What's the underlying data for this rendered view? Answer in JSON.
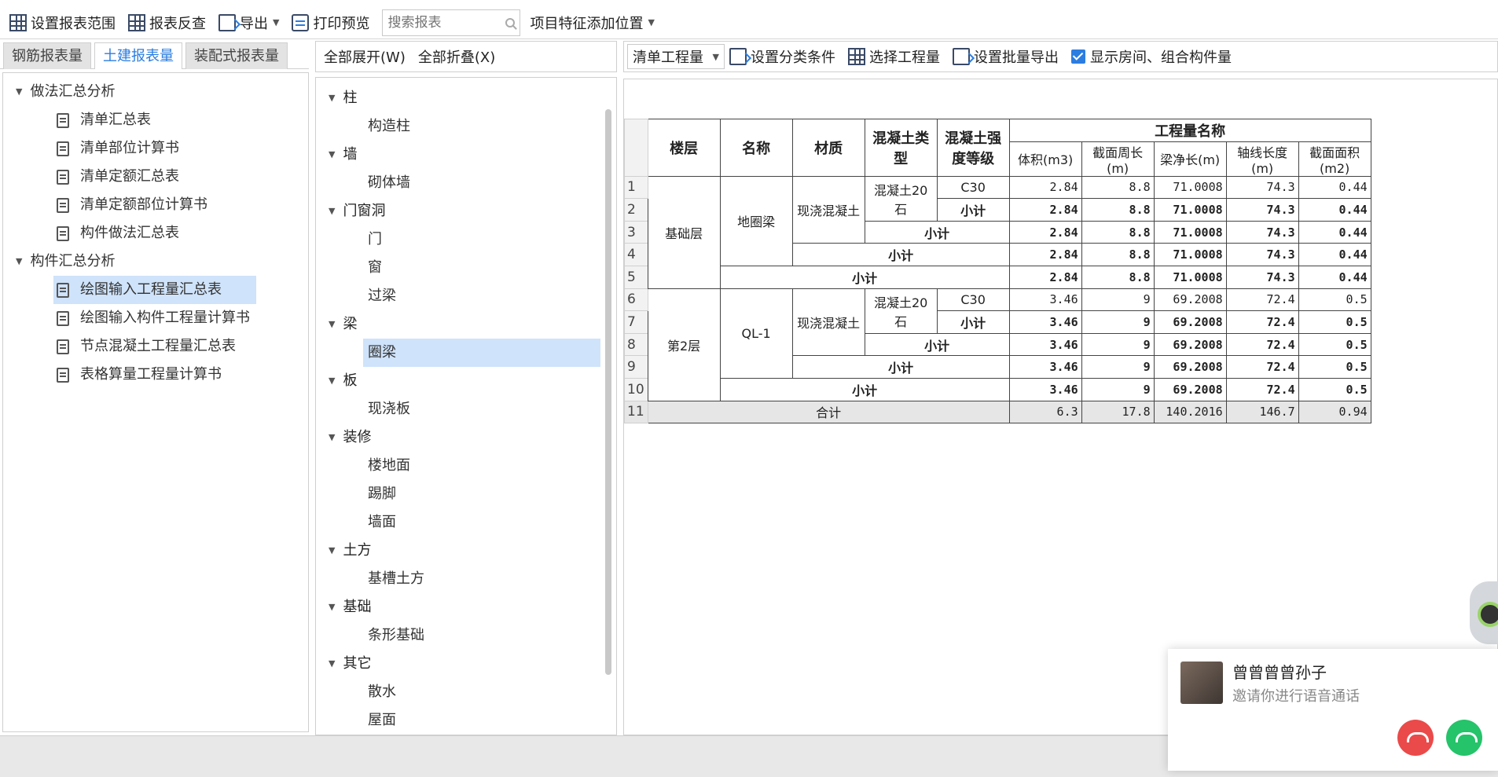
{
  "toolbar": {
    "items": [
      {
        "label": "设置报表范围",
        "icon": "grid-icon"
      },
      {
        "label": "报表反查",
        "icon": "report-search-icon"
      },
      {
        "label": "导出",
        "icon": "export-icon"
      },
      {
        "label": "打印预览",
        "icon": "print-icon"
      }
    ],
    "search_placeholder": "搜索报表",
    "feature_position_label": "项目特征添加位置"
  },
  "left_tabs": [
    "钢筋报表量",
    "土建报表量",
    "装配式报表量"
  ],
  "left_tree": {
    "groups": [
      {
        "label": "做法汇总分析",
        "items": [
          "清单汇总表",
          "清单部位计算书",
          "清单定额汇总表",
          "清单定额部位计算书",
          "构件做法汇总表"
        ]
      },
      {
        "label": "构件汇总分析",
        "items": [
          "绘图输入工程量汇总表",
          "绘图输入构件工程量计算书",
          "节点混凝土工程量汇总表",
          "表格算量工程量计算书"
        ]
      }
    ]
  },
  "mid_panel": {
    "expand_all": "全部展开(W)",
    "collapse_all": "全部折叠(X)",
    "categories": [
      {
        "label": "柱",
        "items": [
          "构造柱"
        ]
      },
      {
        "label": "墙",
        "items": [
          "砌体墙"
        ]
      },
      {
        "label": "门窗洞",
        "items": [
          "门",
          "窗",
          "过梁"
        ]
      },
      {
        "label": "梁",
        "items": [
          "圈梁"
        ]
      },
      {
        "label": "板",
        "items": [
          "现浇板"
        ]
      },
      {
        "label": "装修",
        "items": [
          "楼地面",
          "踢脚",
          "墙面"
        ]
      },
      {
        "label": "土方",
        "items": [
          "基槽土方"
        ]
      },
      {
        "label": "基础",
        "items": [
          "条形基础"
        ]
      },
      {
        "label": "其它",
        "items": [
          "散水",
          "屋面"
        ]
      }
    ]
  },
  "right_toolbar": {
    "qty_select": "清单工程量",
    "set_category": "设置分类条件",
    "select_qty": "选择工程量",
    "batch_export": "设置批量导出",
    "show_room": "显示房间、组合构件量"
  },
  "table": {
    "headers": {
      "floor": "楼层",
      "name": "名称",
      "material": "材质",
      "concrete_type": "混凝土类型",
      "strength": "混凝土强度等级",
      "qty_group": "工程量名称",
      "vol": "体积(m3)",
      "perimeter": "截面周长(m)",
      "net_len": "梁净长(m)",
      "axis_len": "轴线长度(m)",
      "area": "截面面积(m2)"
    },
    "subtotal": "小计",
    "total": "合计",
    "rows": {
      "r1": {
        "floor": "基础层",
        "name": "地圈梁",
        "material": "现浇混凝土",
        "ctype": "混凝土20石",
        "grade": "C30",
        "vol": "2.84",
        "per": "8.8",
        "net": "71.0008",
        "axis": "74.3",
        "area": "0.44"
      },
      "r2": {
        "vol": "2.84",
        "per": "8.8",
        "net": "71.0008",
        "axis": "74.3",
        "area": "0.44"
      },
      "r3": {
        "vol": "2.84",
        "per": "8.8",
        "net": "71.0008",
        "axis": "74.3",
        "area": "0.44"
      },
      "r4": {
        "vol": "2.84",
        "per": "8.8",
        "net": "71.0008",
        "axis": "74.3",
        "area": "0.44"
      },
      "r5": {
        "vol": "2.84",
        "per": "8.8",
        "net": "71.0008",
        "axis": "74.3",
        "area": "0.44"
      },
      "r6": {
        "floor": "第2层",
        "name": "QL-1",
        "material": "现浇混凝土",
        "ctype": "混凝土20石",
        "grade": "C30",
        "vol": "3.46",
        "per": "9",
        "net": "69.2008",
        "axis": "72.4",
        "area": "0.5"
      },
      "r7": {
        "vol": "3.46",
        "per": "9",
        "net": "69.2008",
        "axis": "72.4",
        "area": "0.5"
      },
      "r8": {
        "vol": "3.46",
        "per": "9",
        "net": "69.2008",
        "axis": "72.4",
        "area": "0.5"
      },
      "r9": {
        "vol": "3.46",
        "per": "9",
        "net": "69.2008",
        "axis": "72.4",
        "area": "0.5"
      },
      "r10": {
        "vol": "3.46",
        "per": "9",
        "net": "69.2008",
        "axis": "72.4",
        "area": "0.5"
      },
      "r11": {
        "vol": "6.3",
        "per": "17.8",
        "net": "140.2016",
        "axis": "146.7",
        "area": "0.94"
      }
    },
    "row_numbers": [
      "1",
      "2",
      "3",
      "4",
      "5",
      "6",
      "7",
      "8",
      "9",
      "10",
      "11"
    ]
  },
  "call_popup": {
    "name": "曾曾曾曾孙子",
    "subtitle": "邀请你进行语音通话"
  },
  "colors": {
    "accent": "#2b7de0",
    "selected_bg": "#cfe3fa",
    "decline": "#ea4a4a",
    "accept": "#25c36a"
  }
}
